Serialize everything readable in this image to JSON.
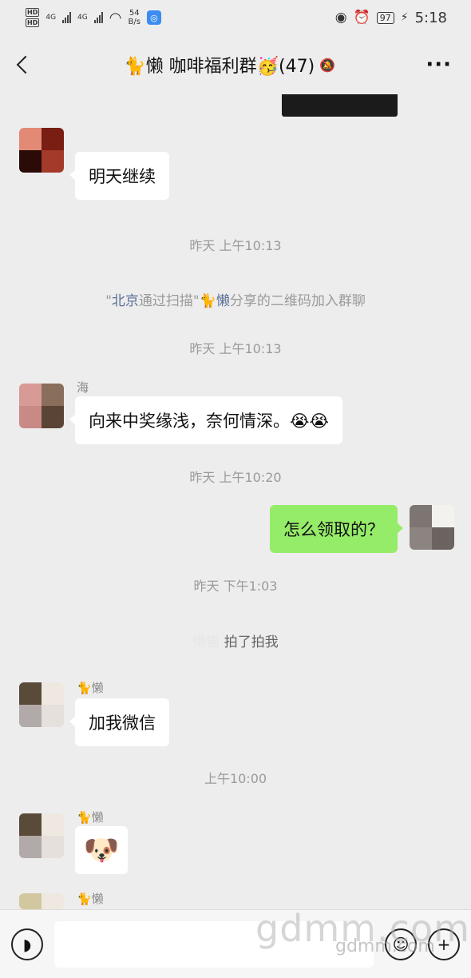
{
  "status_bar": {
    "hd1": "HD",
    "hd2": "HD",
    "net1": "4G",
    "net2": "4G",
    "speed": "54",
    "speed_unit": "B/s",
    "battery": "97",
    "time": "5:18"
  },
  "header": {
    "title": "🐈懒  咖啡福利群🥳(47)"
  },
  "messages": [
    {
      "type": "text",
      "side": "left",
      "text": "明天继续"
    },
    {
      "type": "time",
      "text": "昨天 上午10:13"
    },
    {
      "type": "system",
      "prefix": "\"",
      "name": "北京",
      "mid": "通过扫描\"",
      "name2": "🐈懒",
      "suffix": "分享的二维码加入群聊"
    },
    {
      "type": "time",
      "text": "昨天 上午10:13"
    },
    {
      "type": "text",
      "side": "left",
      "sender": "海",
      "text": "向来中奖缘浅，奈何情深。😭😭"
    },
    {
      "type": "time",
      "text": "昨天 上午10:20"
    },
    {
      "type": "text",
      "side": "right",
      "text": "怎么领取的？"
    },
    {
      "type": "time",
      "text": "昨天 下午1:03"
    },
    {
      "type": "system_pat",
      "text": "拍了拍我"
    },
    {
      "type": "text",
      "side": "left",
      "sender": "🐈懒",
      "text": "加我微信"
    },
    {
      "type": "time",
      "text": "上午10:00"
    },
    {
      "type": "sticker",
      "side": "left",
      "sender": "🐈懒",
      "text": "🐶"
    },
    {
      "type": "partial",
      "sender": "🐈懒"
    }
  ],
  "input_bar": {
    "placeholder": ""
  },
  "watermark": {
    "big": "gdmm.com",
    "small": "gdmm.com"
  },
  "colors": {
    "background": "#ededed",
    "bubble_self": "#95ec69",
    "bubble_other": "#ffffff"
  }
}
